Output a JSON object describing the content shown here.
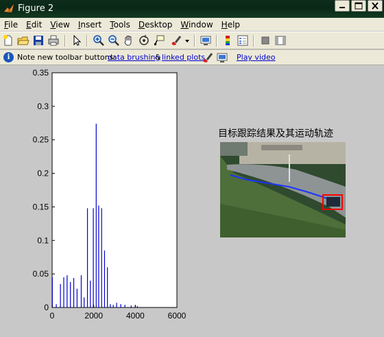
{
  "window": {
    "title": "Figure 2",
    "buttons": [
      "minimize",
      "maximize",
      "close"
    ]
  },
  "menubar": {
    "items": [
      {
        "label": "File"
      },
      {
        "label": "Edit"
      },
      {
        "label": "View"
      },
      {
        "label": "Insert"
      },
      {
        "label": "Tools"
      },
      {
        "label": "Desktop"
      },
      {
        "label": "Window"
      },
      {
        "label": "Help"
      }
    ]
  },
  "toolbar": {
    "buttons": [
      "new-figure-icon",
      "open-file-icon",
      "save-icon",
      "print-icon",
      "pointer-icon",
      "zoom-in-icon",
      "zoom-out-icon",
      "pan-icon",
      "rotate-3d-icon",
      "data-cursor-icon",
      "brush-icon",
      "dropdown-arrow-icon",
      "link-plot-icon",
      "colorbar-icon",
      "legend-icon",
      "hide-plot-tools-icon",
      "show-plot-tools-icon"
    ]
  },
  "infobar": {
    "note": "Note new toolbar buttons:",
    "link_brushing": "data brushing",
    "ampersand": "&",
    "link_linked": "linked plots",
    "link_video": "Play video"
  },
  "image_panel": {
    "title": "目标跟踪结果及其运动轨迹"
  },
  "chart_data": {
    "type": "bar",
    "title": "",
    "xlabel": "",
    "ylabel": "",
    "xlim": [
      0,
      6000
    ],
    "ylim": [
      0,
      0.35
    ],
    "xticks": [
      "0",
      "2000",
      "4000",
      "6000"
    ],
    "yticks": [
      "0",
      "0.05",
      "0.1",
      "0.15",
      "0.2",
      "0.25",
      "0.3",
      "0.35"
    ],
    "color": "#0000cc",
    "x": [
      10,
      200,
      400,
      560,
      720,
      880,
      1040,
      1200,
      1400,
      1540,
      1700,
      1840,
      1980,
      2120,
      2240,
      2380,
      2520,
      2660,
      2800,
      2940,
      3100,
      3300,
      3500,
      3800,
      4000,
      4100
    ],
    "values": [
      0.045,
      0.005,
      0.035,
      0.045,
      0.048,
      0.038,
      0.044,
      0.028,
      0.048,
      0.015,
      0.148,
      0.04,
      0.148,
      0.274,
      0.152,
      0.148,
      0.085,
      0.06,
      0.005,
      0.004,
      0.007,
      0.005,
      0.004,
      0.003,
      0.003,
      0.002
    ]
  },
  "colors": {
    "title_bar": "#0d2a18",
    "menu_bg": "#ece9d8",
    "figure_bg": "#c8c8c8",
    "plot_line": "#0000cc",
    "track_line": "#1a33ff",
    "bbox": "#ff0000"
  }
}
